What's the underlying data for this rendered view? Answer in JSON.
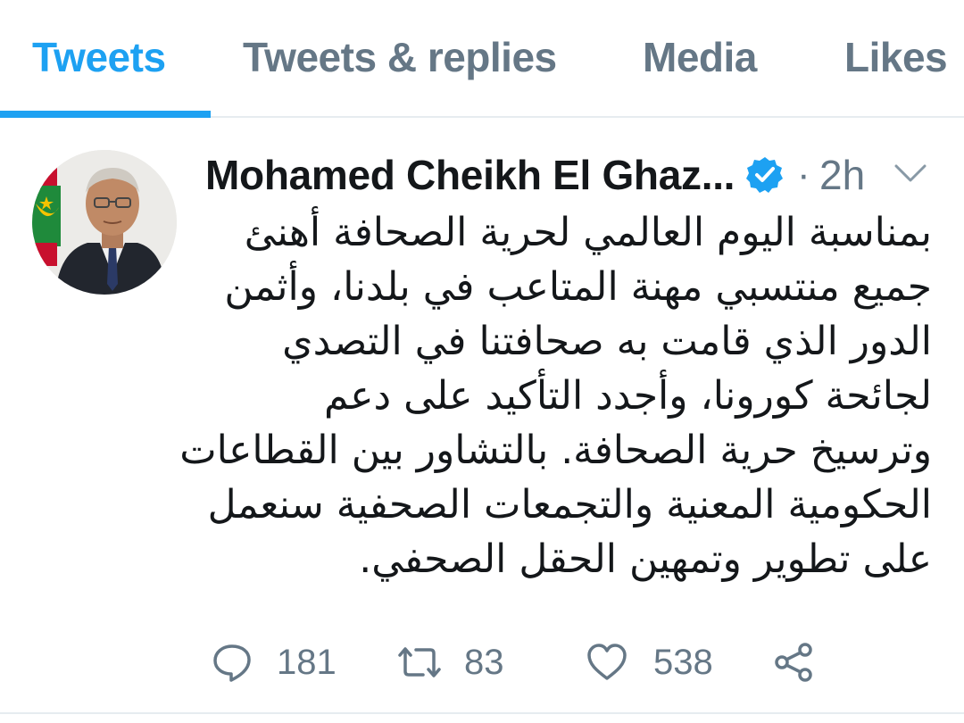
{
  "tabs": [
    {
      "label": "Tweets",
      "active": true
    },
    {
      "label": "Tweets & replies",
      "active": false
    },
    {
      "label": "Media",
      "active": false
    },
    {
      "label": "Likes",
      "active": false
    }
  ],
  "accent_color": "#1da1f2",
  "muted_color": "#657786",
  "tweet": {
    "author_name": "Mohamed Cheikh El Ghaz...",
    "verified": true,
    "separator": "·",
    "time": "2h",
    "body_lines": [
      "بمناسبة اليوم العالمي لحرية الصحافة أهنئ",
      "جميع منتسبي مهنة المتاعب في بلدنا، وأثمن",
      "الدور الذي قامت به صحافتنا في التصدي",
      "لجائحة كورونا، وأجدد التأكيد على دعم",
      "وترسيخ حرية الصحافة. بالتشاور بين القطاعات",
      "الحكومية المعنية والتجمعات الصحفية سنعمل",
      "على تطوير وتمهين الحقل الصحفي."
    ],
    "replies": "181",
    "retweets": "83",
    "likes": "538",
    "icons": {
      "reply": "reply-icon",
      "retweet": "retweet-icon",
      "like": "heart-icon",
      "share": "share-icon",
      "verified": "verified-badge-icon",
      "menu": "chevron-down-icon",
      "avatar": "avatar"
    }
  }
}
